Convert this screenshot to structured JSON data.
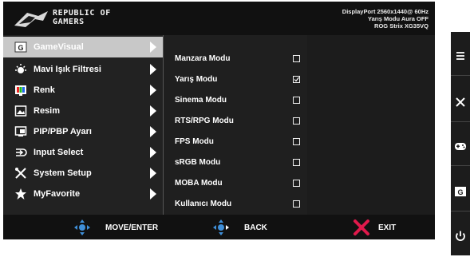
{
  "brand": {
    "line1": "REPUBLIC OF",
    "line2": "GAMERS"
  },
  "info": {
    "line1": "DisplayPort 2560x1440@ 60Hz",
    "line2": "Yarış Modu Aura OFF",
    "line3": "ROG Strix XG35VQ"
  },
  "menu": [
    {
      "label": "GameVisual",
      "icon": "gamevisual-icon"
    },
    {
      "label": "Mavi Işık Filtresi",
      "icon": "blue-light-icon"
    },
    {
      "label": "Renk",
      "icon": "color-icon"
    },
    {
      "label": "Resim",
      "icon": "image-icon"
    },
    {
      "label": "PIP/PBP Ayarı",
      "icon": "pip-icon"
    },
    {
      "label": "Input Select",
      "icon": "input-select-icon"
    },
    {
      "label": "System Setup",
      "icon": "system-setup-icon"
    },
    {
      "label": "MyFavorite",
      "icon": "star-icon"
    }
  ],
  "submenu": [
    {
      "label": "Manzara Modu",
      "checked": false
    },
    {
      "label": "Yarış Modu",
      "checked": true
    },
    {
      "label": "Sinema Modu",
      "checked": false
    },
    {
      "label": "RTS/RPG Modu",
      "checked": false
    },
    {
      "label": "FPS Modu",
      "checked": false
    },
    {
      "label": "sRGB Modu",
      "checked": false
    },
    {
      "label": "MOBA Modu",
      "checked": false
    },
    {
      "label": "Kullanıcı Modu",
      "checked": false
    }
  ],
  "footer": {
    "move": "MOVE/ENTER",
    "back": "BACK",
    "exit": "EXIT"
  },
  "side_buttons": [
    "menu-icon",
    "close-icon",
    "gamepad-icon",
    "gamevisual-icon",
    "power-icon"
  ],
  "colors": {
    "active_item": "#c8c8c8",
    "exit_x": "#e0194b",
    "nav_blue": "#3f8fd9"
  }
}
